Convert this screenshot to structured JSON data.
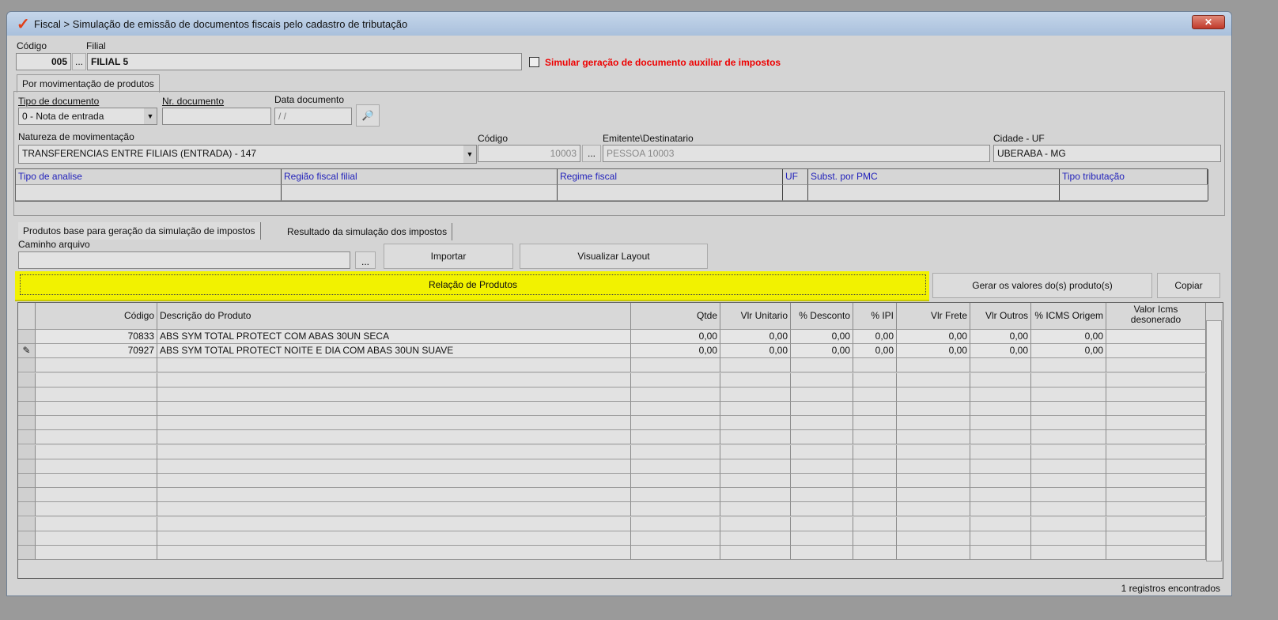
{
  "window": {
    "title": "Fiscal > Simulação de emissão de documentos fiscais pelo cadastro de tributação",
    "close_label": "✕"
  },
  "header": {
    "codigo_label": "Código",
    "codigo_value": "005",
    "filial_label": "Filial",
    "filial_value": "FILIAL 5",
    "lookup": "...",
    "simular_label": "Simular geração de documento auxiliar de impostos",
    "simular_checked": false
  },
  "tabs_top": [
    "Por movimentação de produtos"
  ],
  "doc": {
    "tipo_label": "Tipo de documento",
    "tipo_value": "0 - Nota de entrada",
    "nr_label": "Nr. documento",
    "nr_value": "",
    "data_label": "Data documento",
    "data_value": " /  /",
    "natureza_label": "Natureza de movimentação",
    "natureza_value": "TRANSFERENCIAS ENTRE FILIAIS (ENTRADA) - 147",
    "cod_label": "Código",
    "cod_value": "10003",
    "emit_label": "Emitente\\Destinatario",
    "emit_value": "PESSOA 10003",
    "cidade_label": "Cidade - UF",
    "cidade_value": "UBERABA - MG"
  },
  "analysis_columns": [
    "Tipo de analise",
    "Região fiscal filial",
    "Regime fiscal",
    "UF",
    "Subst. por PMC",
    "Tipo tributação"
  ],
  "tabs_bottom": [
    "Produtos base para geração da simulação de impostos",
    "Resultado da simulação dos impostos"
  ],
  "import": {
    "caminho_label": "Caminho arquivo",
    "caminho_value": "",
    "browse": "...",
    "importar": "Importar",
    "visualizar": "Visualizar Layout"
  },
  "relacao": {
    "title": "Relação de Produtos",
    "gerar": "Gerar os valores do(s) produto(s)",
    "copiar": "Copiar",
    "highlight": "#f2f200"
  },
  "grid": {
    "columns": [
      "",
      "Código",
      "Descrição do Produto",
      "Qtde",
      "Vlr Unitario",
      "% Desconto",
      "% IPI",
      "Vlr Frete",
      "Vlr Outros",
      "% ICMS Origem",
      "Valor Icms desonerado"
    ],
    "rows": [
      [
        "",
        "70833",
        "ABS SYM TOTAL PROTECT COM ABAS 30UN SECA",
        "0,00",
        "0,00",
        "0,00",
        "0,00",
        "0,00",
        "0,00",
        "0,00",
        ""
      ],
      [
        "✎",
        "70927",
        "ABS SYM TOTAL PROTECT NOITE E DIA COM ABAS 30UN SUAVE",
        "0,00",
        "0,00",
        "0,00",
        "0,00",
        "0,00",
        "0,00",
        "0,00",
        ""
      ]
    ],
    "status": "1 registros encontrados"
  }
}
